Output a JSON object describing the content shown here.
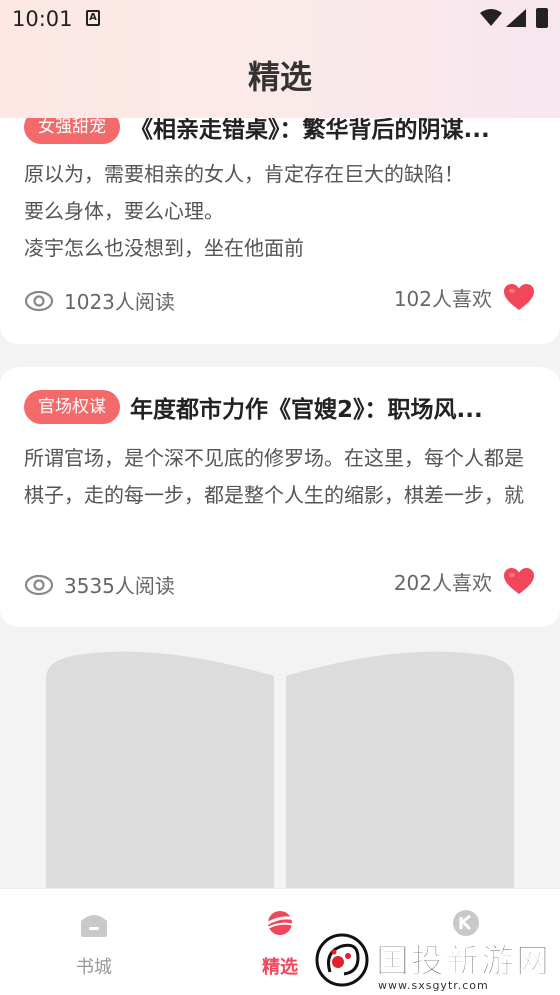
{
  "status_bar": {
    "time": "10:01",
    "a_badge": "A"
  },
  "header": {
    "title": "精选"
  },
  "articles": [
    {
      "tag": "女强甜宠",
      "title": "《相亲走错桌》：繁华背后的阴谋...",
      "description": "原以为，需要相亲的女人，肯定存在巨大的缺陷！\n要么身体，要么心理。\n凌宇怎么也没想到，坐在他面前",
      "reads": "1023人阅读",
      "likes": "102人喜欢"
    },
    {
      "tag": "官场权谋",
      "title": "年度都市力作《官嫂2》：职场风...",
      "description": "所谓官场，是个深不见底的修罗场。在这里，每个人都是棋子，走的每一步，都是整个人生的缩影，棋差一步，就",
      "reads": "3535人阅读",
      "likes": "202人喜欢"
    }
  ],
  "tab_bar": {
    "tabs": [
      {
        "label": "书城",
        "icon": "bookstore-icon"
      },
      {
        "label": "精选",
        "icon": "planet-icon"
      },
      {
        "label": "",
        "icon": "profile-icon"
      }
    ],
    "active_color": "#f0475b"
  },
  "watermark": {
    "text": "国投新游网",
    "url": "www.sxsgytr.com"
  },
  "colors": {
    "tag": "#f46a6a",
    "heart": "#f0475b",
    "header_gradient": "#fde8e4"
  }
}
